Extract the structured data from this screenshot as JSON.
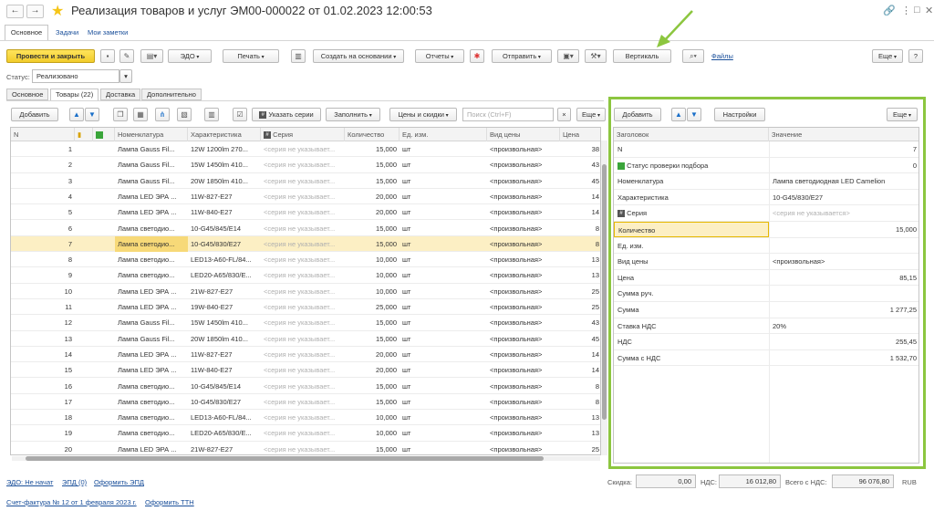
{
  "window": {
    "title": "Реализация товаров и услуг ЭМ00-000022 от 01.02.2023 12:00:53",
    "nav_back": "←",
    "nav_forward": "→",
    "link_icon": "🔗",
    "more_icon": "⋮",
    "maximize_icon": "□",
    "close_icon": "✕"
  },
  "top_tabs": {
    "main": "Основное",
    "tasks": "Задачи",
    "notes": "Мои заметки"
  },
  "toolbar": {
    "post_close": "Провести и закрыть",
    "edo": "ЭДО",
    "print": "Печать",
    "create_basis": "Создать на основании",
    "reports": "Отчеты",
    "send": "Отправить",
    "vertical": "Вертикаль",
    "files": "Файлы",
    "more": "Еще"
  },
  "status": {
    "label": "Статус:",
    "value": "Реализовано"
  },
  "tabs": [
    "Основное",
    "Товары (22)",
    "Доставка",
    "Дополнительно"
  ],
  "goods_toolbar": {
    "add": "Добавить",
    "specify_series": "Указать серии",
    "fill": "Заполнить",
    "prices_discounts": "Цены и скидки",
    "search_placeholder": "Поиск (Ctrl+F)",
    "clear": "×",
    "more": "Еще"
  },
  "columns": {
    "n": "N",
    "nomenclature": "Номенклатура",
    "characteristic": "Характеристика",
    "series": "Серия",
    "quantity": "Количество",
    "unit": "Ед. изм.",
    "price_type": "Вид цены",
    "price": "Цена"
  },
  "rows": [
    {
      "n": "1",
      "nom": "Лампа Gauss Fil...",
      "char": "12W 1200lm 270...",
      "series": "<серия не указывает...",
      "qty": "15,000",
      "unit": "шт",
      "pt": "<произвольная>",
      "price": "38"
    },
    {
      "n": "2",
      "nom": "Лампа Gauss Fil...",
      "char": "15W 1450lm 410...",
      "series": "<серия не указывает...",
      "qty": "15,000",
      "unit": "шт",
      "pt": "<произвольная>",
      "price": "43"
    },
    {
      "n": "3",
      "nom": "Лампа Gauss Fil...",
      "char": "20W 1850lm 410...",
      "series": "<серия не указывает...",
      "qty": "15,000",
      "unit": "шт",
      "pt": "<произвольная>",
      "price": "45"
    },
    {
      "n": "4",
      "nom": "Лампа LED ЭРА ...",
      "char": "11W-827-E27",
      "series": "<серия не указывает...",
      "qty": "20,000",
      "unit": "шт",
      "pt": "<произвольная>",
      "price": "14"
    },
    {
      "n": "5",
      "nom": "Лампа LED ЭРА ...",
      "char": "11W-840-E27",
      "series": "<серия не указывает...",
      "qty": "20,000",
      "unit": "шт",
      "pt": "<произвольная>",
      "price": "14"
    },
    {
      "n": "6",
      "nom": "Лампа светодио...",
      "char": "10-G45/845/E14",
      "series": "<серия не указывает...",
      "qty": "15,000",
      "unit": "шт",
      "pt": "<произвольная>",
      "price": "8"
    },
    {
      "n": "7",
      "nom": "Лампа светодио...",
      "char": "10-G45/830/E27",
      "series": "<серия не указывает...",
      "qty": "15,000",
      "unit": "шт",
      "pt": "<произвольная>",
      "price": "8"
    },
    {
      "n": "8",
      "nom": "Лампа светодио...",
      "char": "LED13-A60-FL/84...",
      "series": "<серия не указывает...",
      "qty": "10,000",
      "unit": "шт",
      "pt": "<произвольная>",
      "price": "13"
    },
    {
      "n": "9",
      "nom": "Лампа светодио...",
      "char": "LED20-A65/830/E...",
      "series": "<серия не указывает...",
      "qty": "10,000",
      "unit": "шт",
      "pt": "<произвольная>",
      "price": "13"
    },
    {
      "n": "10",
      "nom": "Лампа LED ЭРА ...",
      "char": "21W-827-E27",
      "series": "<серия не указывает...",
      "qty": "10,000",
      "unit": "шт",
      "pt": "<произвольная>",
      "price": "25"
    },
    {
      "n": "11",
      "nom": "Лампа LED ЭРА ...",
      "char": "19W-840-E27",
      "series": "<серия не указывает...",
      "qty": "25,000",
      "unit": "шт",
      "pt": "<произвольная>",
      "price": "25"
    },
    {
      "n": "12",
      "nom": "Лампа Gauss Fil...",
      "char": "15W 1450lm 410...",
      "series": "<серия не указывает...",
      "qty": "15,000",
      "unit": "шт",
      "pt": "<произвольная>",
      "price": "43"
    },
    {
      "n": "13",
      "nom": "Лампа Gauss Fil...",
      "char": "20W 1850lm 410...",
      "series": "<серия не указывает...",
      "qty": "15,000",
      "unit": "шт",
      "pt": "<произвольная>",
      "price": "45"
    },
    {
      "n": "14",
      "nom": "Лампа LED ЭРА ...",
      "char": "11W-827-E27",
      "series": "<серия не указывает...",
      "qty": "20,000",
      "unit": "шт",
      "pt": "<произвольная>",
      "price": "14"
    },
    {
      "n": "15",
      "nom": "Лампа LED ЭРА ...",
      "char": "11W-840-E27",
      "series": "<серия не указывает...",
      "qty": "20,000",
      "unit": "шт",
      "pt": "<произвольная>",
      "price": "14"
    },
    {
      "n": "16",
      "nom": "Лампа светодио...",
      "char": "10-G45/845/E14",
      "series": "<серия не указывает...",
      "qty": "15,000",
      "unit": "шт",
      "pt": "<произвольная>",
      "price": "8"
    },
    {
      "n": "17",
      "nom": "Лампа светодио...",
      "char": "10-G45/830/E27",
      "series": "<серия не указывает...",
      "qty": "15,000",
      "unit": "шт",
      "pt": "<произвольная>",
      "price": "8"
    },
    {
      "n": "18",
      "nom": "Лампа светодио...",
      "char": "LED13-A60-FL/84...",
      "series": "<серия не указывает...",
      "qty": "10,000",
      "unit": "шт",
      "pt": "<произвольная>",
      "price": "13"
    },
    {
      "n": "19",
      "nom": "Лампа светодио...",
      "char": "LED20-A65/830/E...",
      "series": "<серия не указывает...",
      "qty": "10,000",
      "unit": "шт",
      "pt": "<произвольная>",
      "price": "13"
    },
    {
      "n": "20",
      "nom": "Лампа LED ЭРА ...",
      "char": "21W-827-E27",
      "series": "<серия не указывает...",
      "qty": "15,000",
      "unit": "шт",
      "pt": "<произвольная>",
      "price": "25"
    }
  ],
  "panel": {
    "add": "Добавить",
    "settings": "Настройки",
    "more": "Еще",
    "col_header": "Заголовок",
    "col_value": "Значение",
    "rows": [
      {
        "k": "N",
        "v": "7",
        "num": true
      },
      {
        "k": "Статус проверки подбора",
        "v": "0",
        "num": true,
        "icon": "green"
      },
      {
        "k": "Номенклатура",
        "v": "Лампа светодиодная LED Camelion"
      },
      {
        "k": "Характеристика",
        "v": "10-G45/830/E27"
      },
      {
        "k": "Серия",
        "v": "<серия не указывается>",
        "ph": true,
        "icon": "hash"
      },
      {
        "k": "Количество",
        "v": "15,000",
        "num": true,
        "sel": true
      },
      {
        "k": "Ед. изм.",
        "v": ""
      },
      {
        "k": "Вид цены",
        "v": "<произвольная>"
      },
      {
        "k": "Цена",
        "v": "85,15",
        "num": true
      },
      {
        "k": "Сумма руч.",
        "v": ""
      },
      {
        "k": "Сумма",
        "v": "1 277,25",
        "num": true
      },
      {
        "k": "Ставка НДС",
        "v": "20%"
      },
      {
        "k": "НДС",
        "v": "255,45",
        "num": true
      },
      {
        "k": "Сумма с НДС",
        "v": "1 532,70",
        "num": true
      }
    ]
  },
  "totals": {
    "discount_label": "Скидка:",
    "discount": "0,00",
    "vat_label": "НДС:",
    "vat": "16 012,80",
    "total_label": "Всего с НДС:",
    "total": "96 076,80",
    "currency": "RUB"
  },
  "footer": {
    "edo_status": "ЭДО: Не начат",
    "epd": "ЭПД (0)",
    "make_epd": "Оформить ЭПД",
    "invoice": "Счет-фактура № 12 от 1 февраля 2023 г.",
    "make_ttn": "Оформить ТТН"
  },
  "colors": {
    "accent_green": "#8cc63f",
    "primary_yellow": "#f2cc2a",
    "link": "#1a4f9a"
  }
}
